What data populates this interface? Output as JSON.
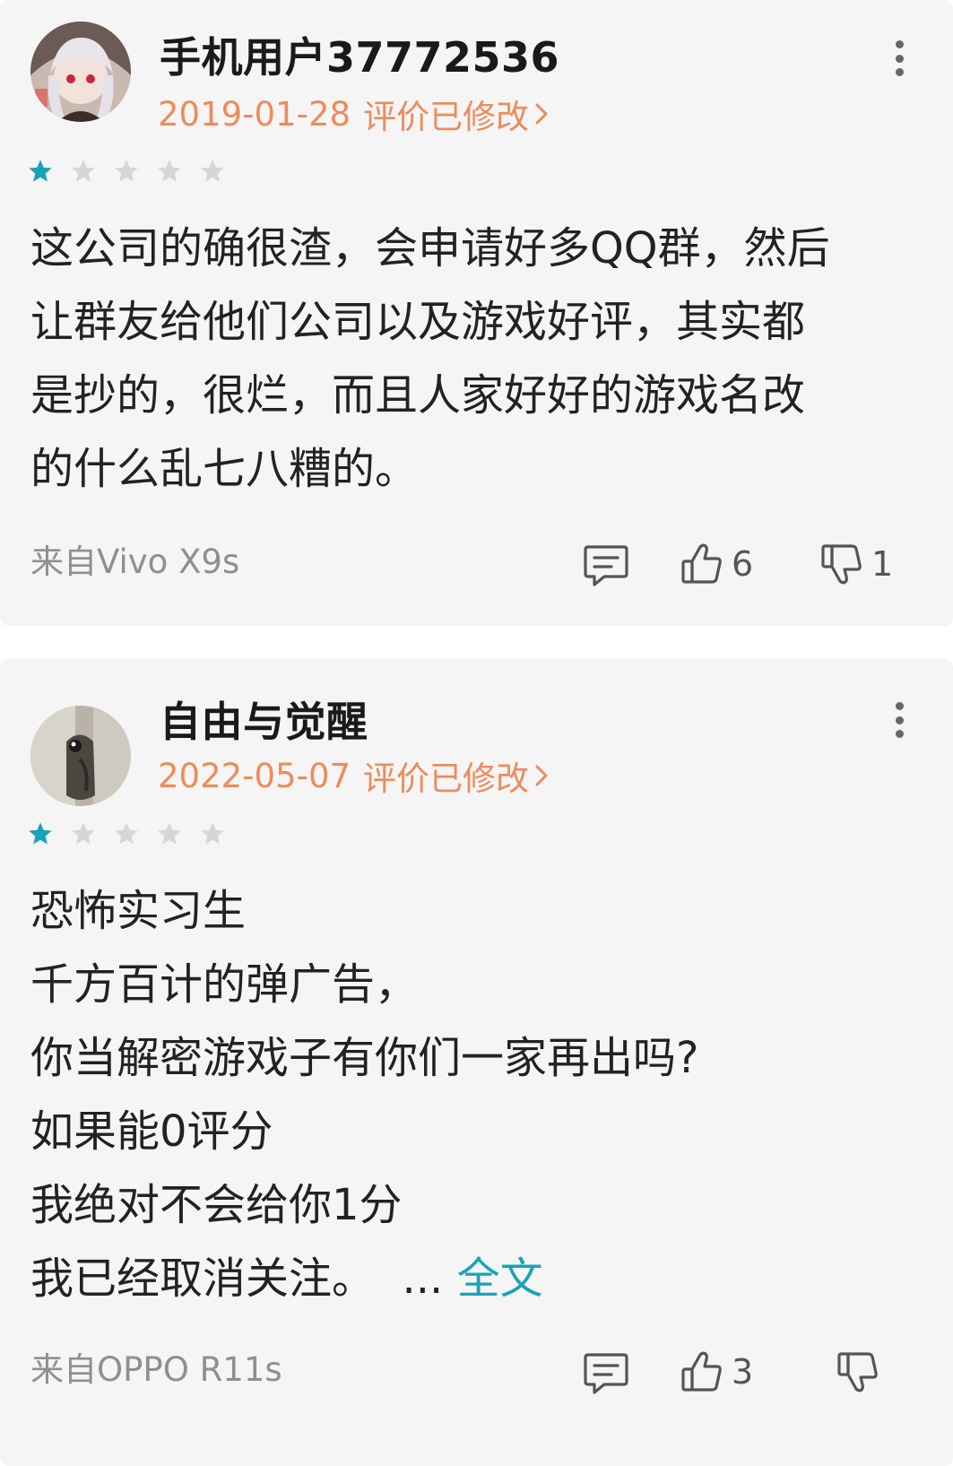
{
  "reviews": [
    {
      "username": "手机用户37772536",
      "date": "2019-01-28",
      "edited": "评价已修改",
      "rating": 1,
      "text_lines": [
        "这公司的确很渣，会申请好多QQ群，然后",
        "让群友给他们公司以及游戏好评，其实都",
        "是抄的，很烂，而且人家好好的游戏名改",
        "的什么乱七八糟的。"
      ],
      "device": "来自Vivo X9s",
      "likes": "6",
      "dislikes": "1"
    },
    {
      "username": "自由与觉醒",
      "date": "2022-05-07",
      "edited": "评价已修改",
      "rating": 1,
      "text_lines": [
        "恐怖实习生",
        "千方百计的弹广告，",
        "你当解密游戏子有你们一家再出吗?",
        "如果能0评分",
        "我绝对不会给你1分",
        "我已经取消关注。"
      ],
      "ellipsis": "...",
      "more_label": "全文",
      "device": "来自OPPO R11s",
      "likes": "3",
      "dislikes": ""
    }
  ],
  "colors": {
    "accent_orange": "#ee8b5c",
    "star_active": "#19a3b8",
    "star_inactive": "#d6d6d6",
    "link": "#19a3b8"
  },
  "icons": [
    "avatar",
    "chevron-right-icon",
    "more-vertical-icon",
    "star-icon",
    "comment-icon",
    "thumbs-up-icon",
    "thumbs-down-icon"
  ]
}
